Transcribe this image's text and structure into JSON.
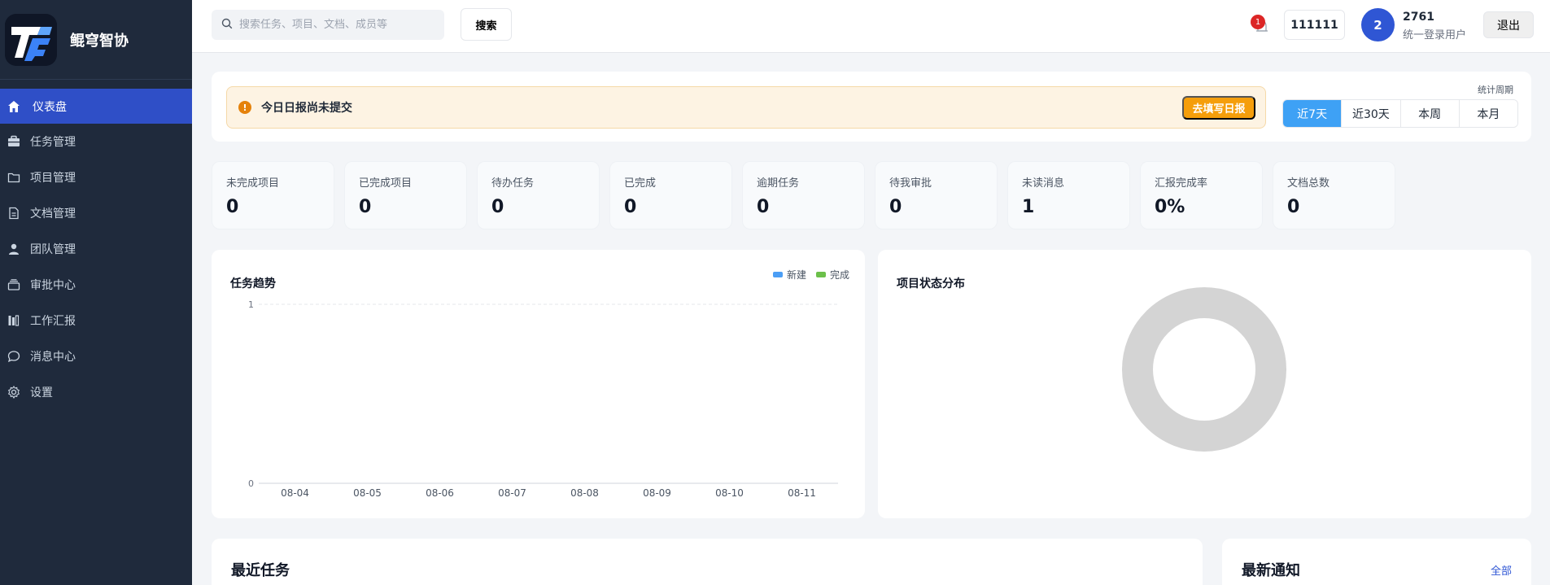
{
  "app": {
    "name": "鲲穹智协"
  },
  "sidebar": {
    "items": [
      {
        "label": "仪表盘",
        "icon": "home-icon",
        "active": true
      },
      {
        "label": "任务管理",
        "icon": "briefcase-icon"
      },
      {
        "label": "项目管理",
        "icon": "folder-icon"
      },
      {
        "label": "文档管理",
        "icon": "document-icon"
      },
      {
        "label": "团队管理",
        "icon": "user-icon"
      },
      {
        "label": "审批中心",
        "icon": "stack-icon"
      },
      {
        "label": "工作汇报",
        "icon": "report-icon"
      },
      {
        "label": "消息中心",
        "icon": "chat-icon"
      },
      {
        "label": "设置",
        "icon": "gear-icon"
      }
    ]
  },
  "topbar": {
    "search_placeholder": "搜索任务、项目、文档、成员等",
    "search_button": "搜索",
    "notification_count": "1",
    "code": "111111",
    "avatar_text": "2",
    "user_name": "2761",
    "user_sub": "统一登录用户",
    "logout": "退出"
  },
  "alert": {
    "icon_text": "!",
    "message": "今日日报尚未提交",
    "action": "去填写日报"
  },
  "period": {
    "label": "统计周期",
    "options": [
      "近7天",
      "近30天",
      "本周",
      "本月"
    ],
    "selected": "近7天"
  },
  "stats": [
    {
      "label": "未完成项目",
      "value": "0"
    },
    {
      "label": "已完成项目",
      "value": "0"
    },
    {
      "label": "待办任务",
      "value": "0"
    },
    {
      "label": "已完成",
      "value": "0"
    },
    {
      "label": "逾期任务",
      "value": "0"
    },
    {
      "label": "待我审批",
      "value": "0"
    },
    {
      "label": "未读消息",
      "value": "1"
    },
    {
      "label": "汇报完成率",
      "value": "0%"
    },
    {
      "label": "文档总数",
      "value": "0"
    }
  ],
  "colors": {
    "new": "#4b9ef5",
    "done": "#6cc04a",
    "donut": "#d4d4d4"
  },
  "chart_data": [
    {
      "type": "line",
      "title": "任务趋势",
      "categories": [
        "08-04",
        "08-05",
        "08-06",
        "08-07",
        "08-08",
        "08-09",
        "08-10",
        "08-11"
      ],
      "series": [
        {
          "name": "新建",
          "values": [
            0,
            0,
            0,
            0,
            0,
            0,
            0,
            0
          ]
        },
        {
          "name": "完成",
          "values": [
            0,
            0,
            0,
            0,
            0,
            0,
            0,
            0
          ]
        }
      ],
      "ylim": [
        0,
        1
      ],
      "yticks": [
        "0",
        "1"
      ],
      "legend": "top-right"
    },
    {
      "type": "pie",
      "title": "项目状态分布",
      "categories": [],
      "values": []
    }
  ],
  "bottom": {
    "recent_tasks_title": "最近任务",
    "notices_title": "最新通知",
    "notices_all": "全部"
  }
}
